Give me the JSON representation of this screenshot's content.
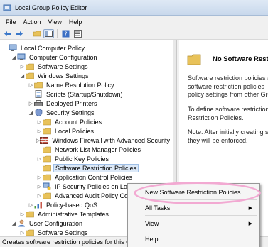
{
  "window": {
    "title": "Local Group Policy Editor"
  },
  "menu": [
    "File",
    "Action",
    "View",
    "Help"
  ],
  "toolbar": {
    "buttons": [
      "back-icon",
      "forward-icon",
      "up-folder-icon",
      "show-hide-tree-icon",
      "help-icon",
      "properties-icon"
    ]
  },
  "tree": [
    {
      "label": "Local Computer Policy",
      "depth": 0,
      "expander": "",
      "icon": "computer"
    },
    {
      "label": "Computer Configuration",
      "depth": 1,
      "expander": "◢",
      "icon": "computer"
    },
    {
      "label": "Software Settings",
      "depth": 2,
      "expander": "▷",
      "icon": "folder"
    },
    {
      "label": "Windows Settings",
      "depth": 2,
      "expander": "◢",
      "icon": "folder"
    },
    {
      "label": "Name Resolution Policy",
      "depth": 3,
      "expander": "▷",
      "icon": "folder"
    },
    {
      "label": "Scripts (Startup/Shutdown)",
      "depth": 3,
      "expander": "",
      "icon": "script"
    },
    {
      "label": "Deployed Printers",
      "depth": 3,
      "expander": "▷",
      "icon": "printer"
    },
    {
      "label": "Security Settings",
      "depth": 3,
      "expander": "◢",
      "icon": "security"
    },
    {
      "label": "Account Policies",
      "depth": 4,
      "expander": "▷",
      "icon": "folder"
    },
    {
      "label": "Local Policies",
      "depth": 4,
      "expander": "▷",
      "icon": "folder"
    },
    {
      "label": "Windows Firewall with Advanced Security",
      "depth": 4,
      "expander": "▷",
      "icon": "firewall"
    },
    {
      "label": "Network List Manager Policies",
      "depth": 4,
      "expander": "",
      "icon": "folder"
    },
    {
      "label": "Public Key Policies",
      "depth": 4,
      "expander": "▷",
      "icon": "folder"
    },
    {
      "label": "Software Restriction Policies",
      "depth": 4,
      "expander": "",
      "icon": "folder",
      "selected": true
    },
    {
      "label": "Application Control Policies",
      "depth": 4,
      "expander": "▷",
      "icon": "folder"
    },
    {
      "label": "IP Security Policies on Local",
      "depth": 4,
      "expander": "▷",
      "icon": "ipsec"
    },
    {
      "label": "Advanced Audit Policy Config",
      "depth": 4,
      "expander": "▷",
      "icon": "folder"
    },
    {
      "label": "Policy-based QoS",
      "depth": 3,
      "expander": "▷",
      "icon": "chart"
    },
    {
      "label": "Administrative Templates",
      "depth": 2,
      "expander": "▷",
      "icon": "folder"
    },
    {
      "label": "User Configuration",
      "depth": 1,
      "expander": "◢",
      "icon": "user"
    },
    {
      "label": "Software Settings",
      "depth": 2,
      "expander": "▷",
      "icon": "folder"
    }
  ],
  "details": {
    "heading": "No Software Restriction",
    "paragraphs": [
      [
        "Software restriction policies ar",
        "software restriction policies in",
        "policy settings from other Grou"
      ],
      [
        "To define software restriction",
        "Restriction Policies."
      ],
      [
        "Note: After initially creating so",
        "they will be enforced."
      ]
    ]
  },
  "context_menu": {
    "items": [
      {
        "label": "New Software Restriction Policies",
        "submenu": false
      },
      {
        "label": "All Tasks",
        "submenu": true
      },
      {
        "label": "View",
        "submenu": true
      },
      {
        "label": "Help",
        "submenu": false
      }
    ]
  },
  "status": "Creates software restriction policies for this Group Policy object.",
  "colors": {
    "selection": "#dce9f8",
    "highlight_ring": "#f2a9d2",
    "folder": "#e8c25a"
  }
}
